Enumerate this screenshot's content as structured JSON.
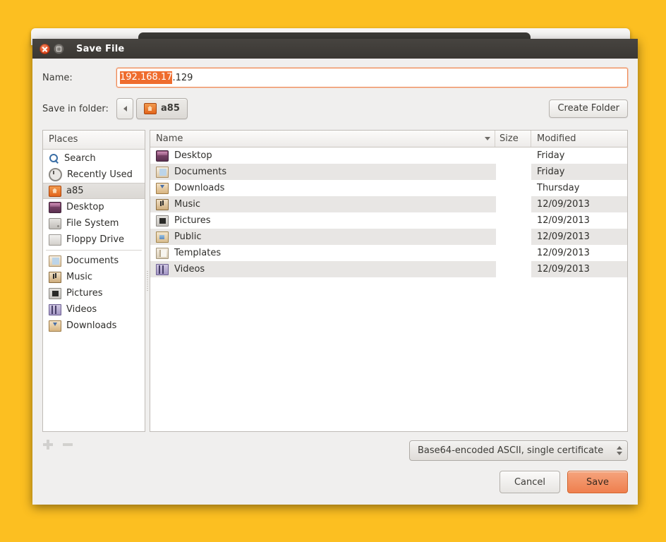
{
  "desktop": {
    "background_color": "#fcbf21"
  },
  "background_window": {
    "present": true
  },
  "dialog": {
    "title": "Save File",
    "window_buttons": {
      "close": "close-icon",
      "maximize": "maximize-icon"
    },
    "name_field": {
      "label": "Name:",
      "selected_text": "192.168.17",
      "remaining_text": ".129",
      "full_value": "192.168.17.129",
      "selection_color": "#ef6c2e",
      "focus_border_color": "#f08a55"
    },
    "folder_row": {
      "label": "Save in folder:",
      "back_button": "back-arrow-icon",
      "breadcrumb": "a85",
      "breadcrumb_icon": "home-folder-icon",
      "create_folder_label": "Create Folder"
    },
    "places": {
      "header": "Places",
      "items": [
        {
          "label": "Search",
          "icon": "search-icon",
          "selected": false,
          "separator_after": false
        },
        {
          "label": "Recently Used",
          "icon": "recent-icon",
          "selected": false,
          "separator_after": false
        },
        {
          "label": "a85",
          "icon": "home-folder-icon",
          "selected": true,
          "separator_after": false
        },
        {
          "label": "Desktop",
          "icon": "desktop-icon",
          "selected": false,
          "separator_after": false
        },
        {
          "label": "File System",
          "icon": "drive-icon",
          "selected": false,
          "separator_after": false
        },
        {
          "label": "Floppy Drive",
          "icon": "floppy-icon",
          "selected": false,
          "separator_after": true
        },
        {
          "label": "Documents",
          "icon": "documents-folder-icon",
          "selected": false,
          "separator_after": false
        },
        {
          "label": "Music",
          "icon": "music-folder-icon",
          "selected": false,
          "separator_after": false
        },
        {
          "label": "Pictures",
          "icon": "pictures-folder-icon",
          "selected": false,
          "separator_after": false
        },
        {
          "label": "Videos",
          "icon": "videos-folder-icon",
          "selected": false,
          "separator_after": false
        },
        {
          "label": "Downloads",
          "icon": "downloads-folder-icon",
          "selected": false,
          "separator_after": false
        }
      ],
      "add_bookmark": "add-bookmark-icon",
      "remove_bookmark": "remove-bookmark-icon"
    },
    "file_list": {
      "columns": {
        "name": "Name",
        "size": "Size",
        "modified": "Modified"
      },
      "sort_indicator": "sort-descending-icon",
      "rows": [
        {
          "name": "Desktop",
          "icon": "desktop-icon",
          "size": "",
          "modified": "Friday"
        },
        {
          "name": "Documents",
          "icon": "documents-folder-icon",
          "size": "",
          "modified": "Friday"
        },
        {
          "name": "Downloads",
          "icon": "downloads-folder-icon",
          "size": "",
          "modified": "Thursday"
        },
        {
          "name": "Music",
          "icon": "music-folder-icon",
          "size": "",
          "modified": "12/09/2013"
        },
        {
          "name": "Pictures",
          "icon": "pictures-folder-icon",
          "size": "",
          "modified": "12/09/2013"
        },
        {
          "name": "Public",
          "icon": "public-folder-icon",
          "size": "",
          "modified": "12/09/2013"
        },
        {
          "name": "Templates",
          "icon": "templates-folder-icon",
          "size": "",
          "modified": "12/09/2013"
        },
        {
          "name": "Videos",
          "icon": "videos-folder-icon",
          "size": "",
          "modified": "12/09/2013"
        }
      ]
    },
    "format_select": {
      "value": "Base64-encoded ASCII, single certificate",
      "arrows_icon": "spinner-arrows-icon"
    },
    "actions": {
      "cancel": "Cancel",
      "save": "Save",
      "save_accent_color": "#ef7f4e"
    }
  }
}
